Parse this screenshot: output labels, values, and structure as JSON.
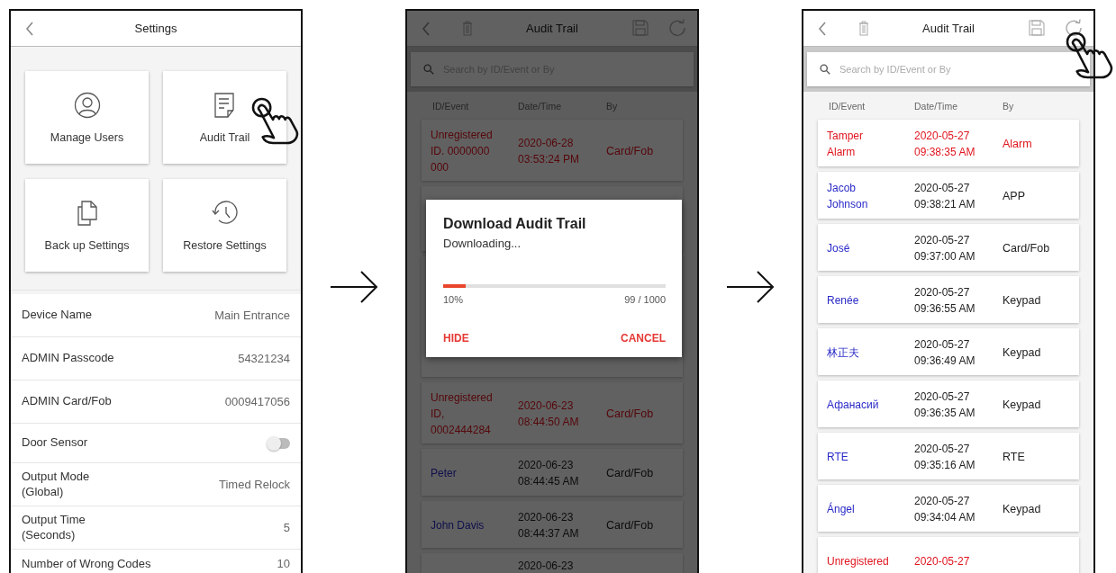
{
  "settings_screen": {
    "title": "Settings",
    "tiles": [
      {
        "label": "Manage Users"
      },
      {
        "label": "Audit Trail"
      },
      {
        "label": "Back up Settings"
      },
      {
        "label": "Restore Settings"
      }
    ],
    "items": [
      {
        "kind": "text",
        "label": "Device Name",
        "value": "Main Entrance"
      },
      {
        "kind": "text",
        "label": "ADMIN Passcode",
        "value": "54321234"
      },
      {
        "kind": "text",
        "label": "ADMIN Card/Fob",
        "value": "0009417056"
      },
      {
        "kind": "toggle",
        "label": "Door Sensor",
        "on": false
      },
      {
        "kind": "text",
        "label": "Output Mode\n(Global)",
        "value": "Timed Relock"
      },
      {
        "kind": "text",
        "label": "Output Time\n(Seconds)",
        "value": "5"
      },
      {
        "kind": "text",
        "label": "Number of Wrong Codes",
        "value": "10"
      }
    ]
  },
  "downloading_screen": {
    "title": "Audit Trail",
    "search": {
      "placeholder": "Search by ID/Event or By"
    },
    "columns": [
      "ID/Event",
      "Date/Time",
      "By"
    ],
    "rows_above": [
      {
        "kind": "alarm",
        "id_event": "Unregistered\nID. 0000000\n000",
        "date_time": "2020-06-28\n03:53:24 PM",
        "by": "Card/Fob"
      }
    ],
    "rows_below": [
      {
        "kind": "alarm",
        "id_event": "Unregistered\nID,\n0002444284",
        "date_time": "2020-06-23\n08:44:50 AM",
        "by": "Card/Fob"
      },
      {
        "kind": "user",
        "id_event": "Peter",
        "date_time": "2020-06-23\n08:44:45 AM",
        "by": "Card/Fob"
      },
      {
        "kind": "user",
        "id_event": "John Davis",
        "date_time": "2020-06-23\n08:44:37 AM",
        "by": "Card/Fob"
      },
      {
        "kind": "user",
        "date_time": "2020-06-23"
      }
    ],
    "dialog": {
      "title": "Download Audit Trail",
      "message": "Downloading...",
      "level": 0.1,
      "percent": "10%",
      "count": "99 / 1000",
      "buttons": [
        "HIDE",
        "CANCEL"
      ]
    }
  },
  "audit_trail_screen": {
    "title": "Audit Trail",
    "search": {
      "placeholder": "Search by ID/Event or By"
    },
    "columns": [
      "ID/Event",
      "Date/Time",
      "By"
    ],
    "rows": [
      {
        "kind": "alarm",
        "id_event": "Tamper\nAlarm",
        "date_time": "2020-05-27\n09:38:35 AM",
        "by": "Alarm"
      },
      {
        "kind": "user",
        "id_event": "Jacob\nJohnson",
        "date_time": "2020-05-27\n09:38:21 AM",
        "by": "APP"
      },
      {
        "kind": "user",
        "id_event": "José",
        "date_time": "2020-05-27\n09:37:00 AM",
        "by": "Card/Fob"
      },
      {
        "kind": "user",
        "id_event": "Renée",
        "date_time": "2020-05-27\n09:36:55 AM",
        "by": "Keypad"
      },
      {
        "kind": "user",
        "id_event": "林正夫",
        "date_time": "2020-05-27\n09:36:49 AM",
        "by": "Keypad"
      },
      {
        "kind": "user",
        "id_event": "Афанасий",
        "date_time": "2020-05-27\n09:36:35 AM",
        "by": "Keypad"
      },
      {
        "kind": "user",
        "id_event": "RTE",
        "date_time": "2020-05-27\n09:35:16 AM",
        "by": "RTE"
      },
      {
        "kind": "user",
        "id_event": "Ángel",
        "date_time": "2020-05-27\n09:34:04 AM",
        "by": "Keypad"
      },
      {
        "kind": "alarm",
        "id_event": "Unregistered",
        "date_time": "2020-05-27"
      }
    ]
  }
}
